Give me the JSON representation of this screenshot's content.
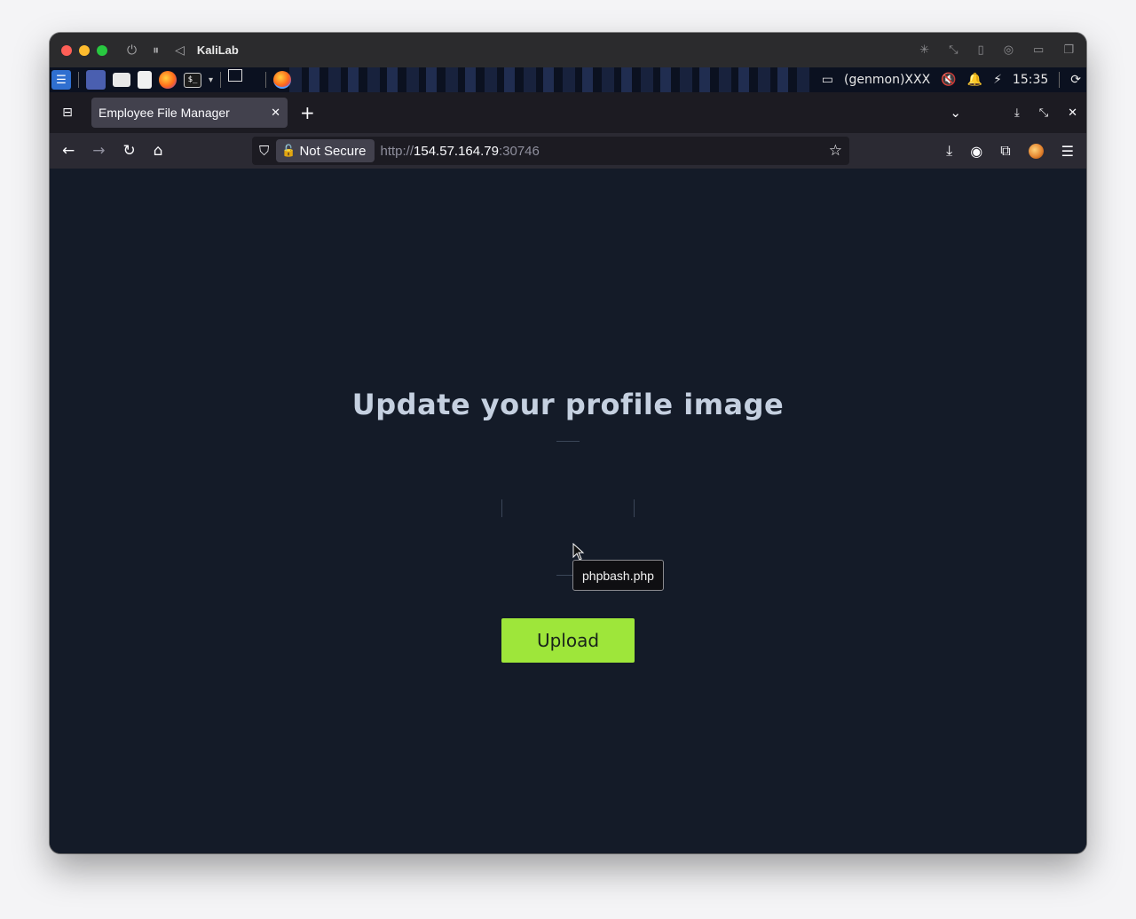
{
  "vm": {
    "title": "KaliLab"
  },
  "panel": {
    "network_label": "(genmon)XXX",
    "clock": "15:35"
  },
  "browser": {
    "tab_title": "Employee File Manager",
    "security_label": "Not Secure",
    "url_scheme": "http://",
    "url_host": "154.57.164.79",
    "url_port": ":30746"
  },
  "page": {
    "heading": "Update your profile image",
    "file_tooltip": "phpbash.php",
    "upload_label": "Upload"
  },
  "colors": {
    "page_background": "#141b28",
    "heading": "#c5d0e0",
    "upload_button": "#9ee63a"
  },
  "icons": [
    "power-icon",
    "pause-icon",
    "back-triangle-icon",
    "shield-icon",
    "lock-warning-icon",
    "star-icon",
    "download-icon",
    "account-icon",
    "extensions-icon",
    "menu-icon"
  ]
}
